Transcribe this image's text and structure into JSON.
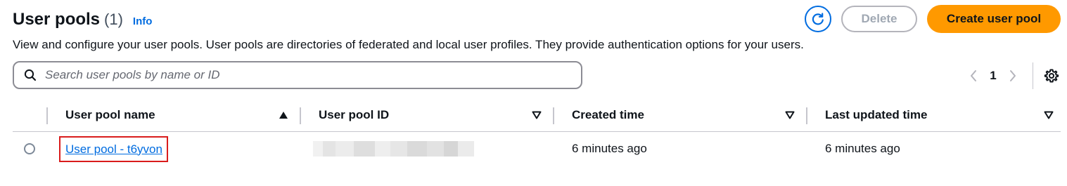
{
  "header": {
    "title": "User pools",
    "count": "(1)",
    "info": "Info",
    "description": "View and configure your user pools. User pools are directories of federated and local user profiles. They provide authentication options for your users."
  },
  "actions": {
    "refresh_icon": "refresh-icon",
    "delete_label": "Delete",
    "create_label": "Create user pool"
  },
  "search": {
    "placeholder": "Search user pools by name or ID",
    "value": ""
  },
  "pagination": {
    "current_page": "1"
  },
  "table": {
    "columns": [
      {
        "label": "User pool name",
        "sort": "ascending"
      },
      {
        "label": "User pool ID",
        "sort": "none"
      },
      {
        "label": "Created time",
        "sort": "none"
      },
      {
        "label": "Last updated time",
        "sort": "none"
      }
    ],
    "rows": [
      {
        "name": "User pool - t6yvon",
        "created": "6 minutes ago",
        "updated": "6 minutes ago"
      }
    ]
  },
  "colors": {
    "accent": "#006ce0",
    "primary_button": "#ff9900",
    "highlight": "#d91c1c"
  }
}
